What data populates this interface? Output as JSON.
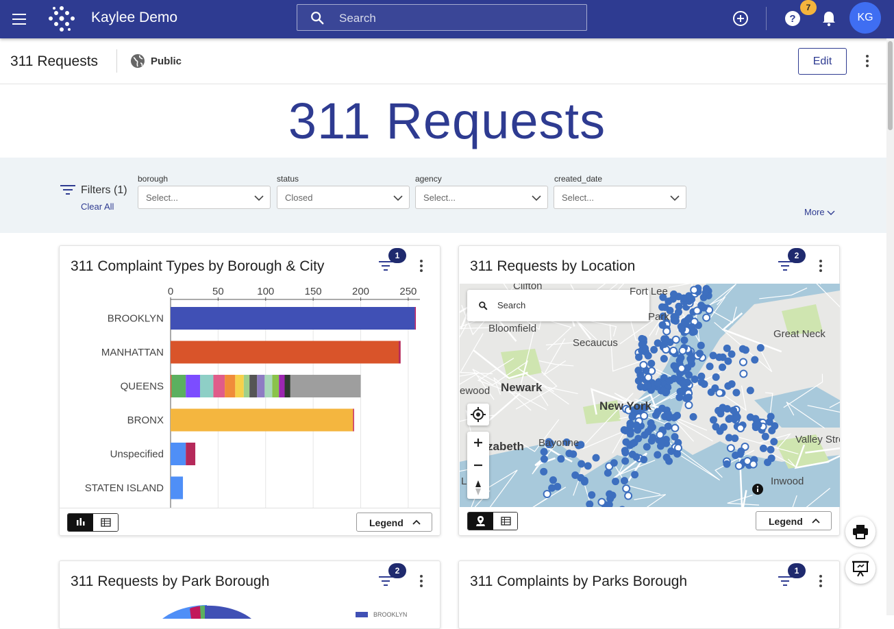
{
  "header": {
    "app_title": "Kaylee Demo",
    "search_placeholder": "Search",
    "notification_count": "7",
    "avatar_initials": "KG"
  },
  "subheader": {
    "page_name": "311 Requests",
    "visibility": "Public",
    "edit_label": "Edit"
  },
  "page_title": "311 Requests",
  "filters": {
    "label": "Filters (1)",
    "clear_all": "Clear All",
    "more": "More",
    "fields": [
      {
        "label": "borough",
        "value": "Select..."
      },
      {
        "label": "status",
        "value": "Closed"
      },
      {
        "label": "agency",
        "value": "Select..."
      },
      {
        "label": "created_date",
        "value": "Select..."
      }
    ]
  },
  "cards": {
    "complaint_types": {
      "title": "311 Complaint Types by Borough & City",
      "filter_count": "1",
      "legend": "Legend"
    },
    "requests_location": {
      "title": "311 Requests by Location",
      "filter_count": "2",
      "legend": "Legend"
    },
    "park_borough": {
      "title": "311 Requests by Park Borough",
      "filter_count": "2",
      "legend_first": "BROOKLYN"
    },
    "parks_complaints": {
      "title": "311 Complaints by Parks Borough",
      "filter_count": "1"
    }
  },
  "map": {
    "search_placeholder": "Search",
    "labels": [
      "Clifton",
      "Fort Lee",
      "Park",
      "Bloomfield",
      "Secaucus",
      "Great Neck",
      "ewood",
      "Newark",
      "New York",
      "Bayonne",
      "zabeth",
      "Valley Stream",
      "Inwood",
      "L"
    ]
  },
  "colors": {
    "brand": "#2e3b91",
    "badge": "#f4b43d",
    "avatar": "#3f6ef2",
    "map_points": "#3d6fbf",
    "water": "#a8c9db",
    "park": "#cfe5b0"
  },
  "chart_data": {
    "type": "bar",
    "orientation": "horizontal",
    "stacked": true,
    "categories": [
      "BROOKLYN",
      "MANHATTAN",
      "QUEENS",
      "BRONX",
      "Unspecified",
      "STATEN ISLAND"
    ],
    "xticks": [
      0,
      50,
      100,
      150,
      200,
      250
    ],
    "xlim": [
      0,
      258
    ],
    "axis_position": "top",
    "segments": [
      [
        {
          "value": 257,
          "color": "#4050b5"
        },
        {
          "value": 1,
          "color": "#c2185b"
        }
      ],
      [
        {
          "value": 240,
          "color": "#d9542a"
        },
        {
          "value": 2,
          "color": "#b5295a"
        }
      ],
      [
        {
          "value": 1,
          "color": "#d9542a"
        },
        {
          "value": 15,
          "color": "#5bb05f"
        },
        {
          "value": 15,
          "color": "#7c4dff"
        },
        {
          "value": 14,
          "color": "#8ecfc6"
        },
        {
          "value": 12,
          "color": "#e05c8a"
        },
        {
          "value": 11,
          "color": "#f08c3a"
        },
        {
          "value": 9,
          "color": "#f6d14b"
        },
        {
          "value": 6,
          "color": "#9fd08a"
        },
        {
          "value": 8,
          "color": "#555555"
        },
        {
          "value": 8,
          "color": "#8e7cc3"
        },
        {
          "value": 8,
          "color": "#a8d8b9"
        },
        {
          "value": 7,
          "color": "#8bc34a"
        },
        {
          "value": 6,
          "color": "#9c27b0"
        },
        {
          "value": 6,
          "color": "#2e3a2e"
        },
        {
          "value": 74,
          "color": "#9e9e9e"
        }
      ],
      [
        {
          "value": 192,
          "color": "#f4b63f"
        },
        {
          "value": 1,
          "color": "#c2185b"
        }
      ],
      [
        {
          "value": 16,
          "color": "#4f8ff7"
        },
        {
          "value": 10,
          "color": "#b5295a"
        }
      ],
      [
        {
          "value": 13,
          "color": "#4f8ff7"
        }
      ]
    ]
  }
}
